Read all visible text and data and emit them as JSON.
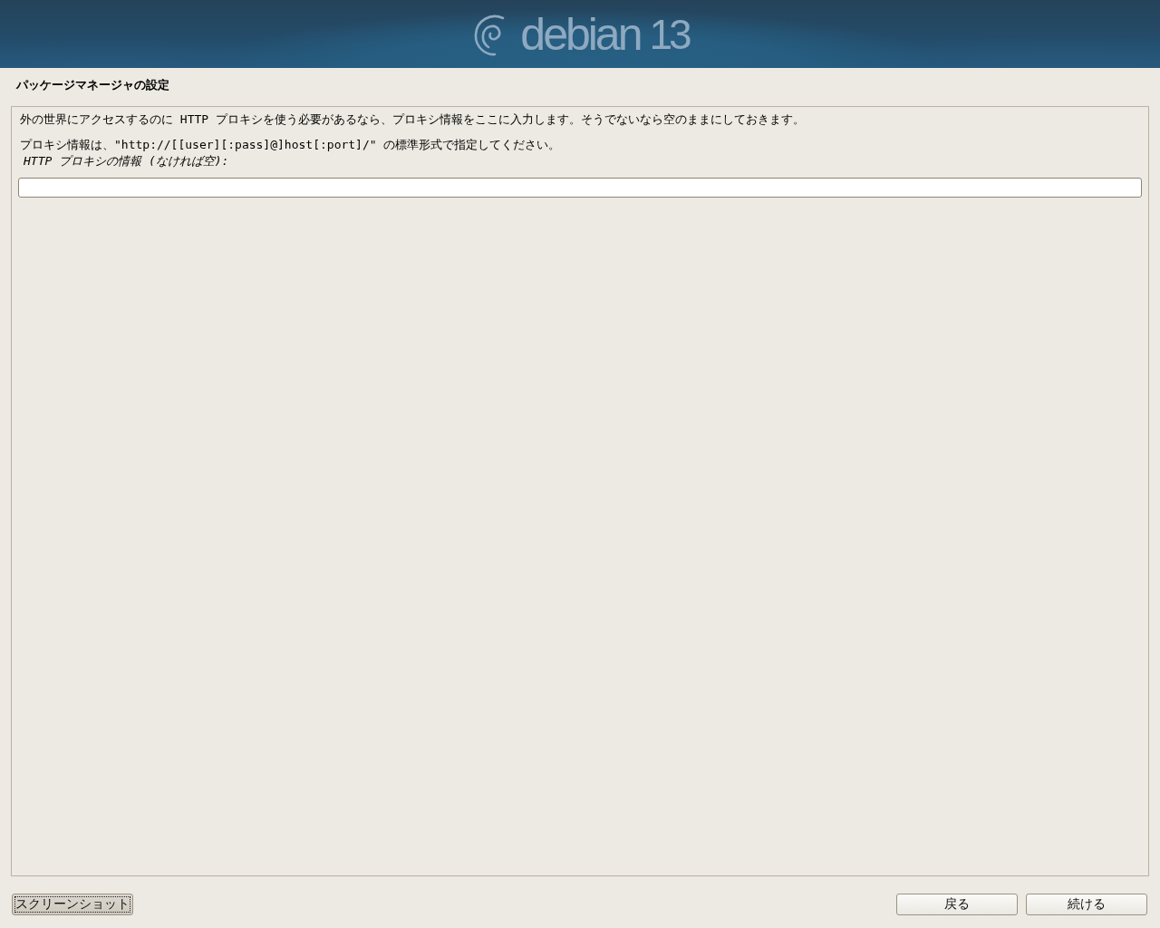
{
  "banner": {
    "logo_text": "debian",
    "version": "13"
  },
  "title": "パッケージマネージャの設定",
  "panel": {
    "paragraphs": [
      "外の世界にアクセスするのに HTTP プロキシを使う必要があるなら、プロキシ情報をここに入力します。そうでないなら空のままにしておきます。",
      "プロキシ情報は、\"http://[[user][:pass]@]host[:port]/\" の標準形式で指定してください。"
    ],
    "field": {
      "label": "HTTP プロキシの情報 (なければ空):"
    }
  },
  "footer": {
    "left_buttons": [
      {
        "label": "スクリーンショット",
        "focused": true
      }
    ],
    "right_buttons": [
      {
        "label": "戻る",
        "focused": false
      },
      {
        "label": "続ける",
        "focused": false
      }
    ]
  }
}
